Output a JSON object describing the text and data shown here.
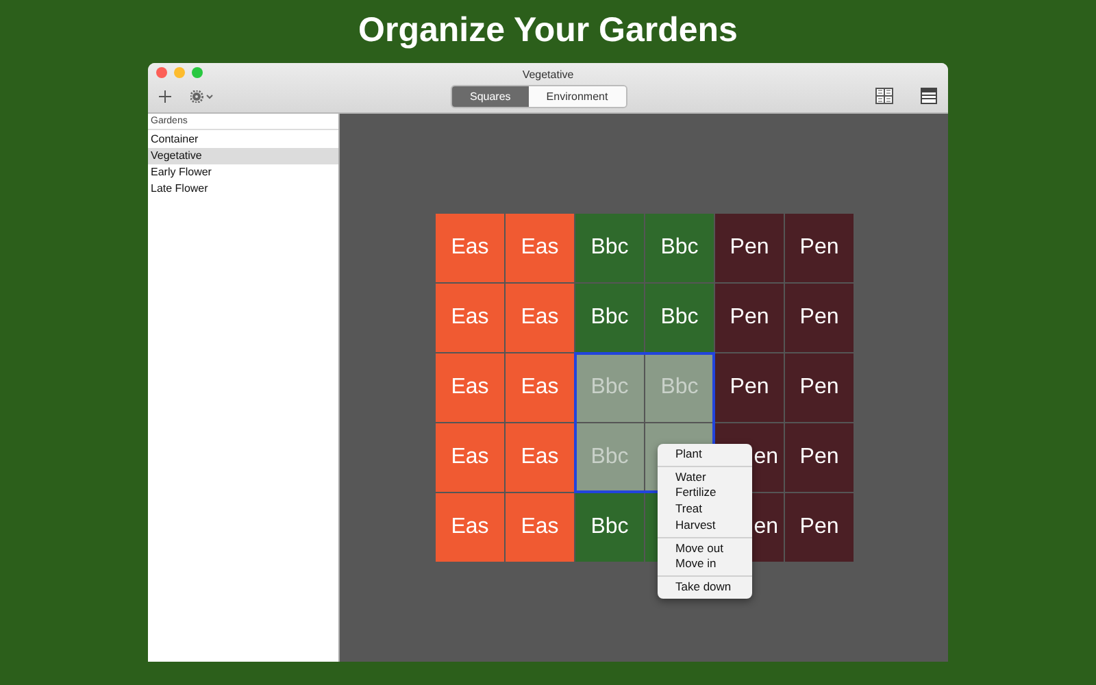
{
  "headline": "Organize Your Gardens",
  "window": {
    "title": "Vegetative"
  },
  "tabs": [
    {
      "label": "Squares",
      "selected": true
    },
    {
      "label": "Environment",
      "selected": false
    }
  ],
  "sidebar": {
    "header": "Gardens",
    "items": [
      {
        "label": "Container",
        "selected": false
      },
      {
        "label": "Vegetative",
        "selected": true
      },
      {
        "label": "Early Flower",
        "selected": false
      },
      {
        "label": "Late Flower",
        "selected": false
      }
    ]
  },
  "grid": {
    "rows": [
      [
        {
          "label": "Eas",
          "color": "#f05a32",
          "selected": false
        },
        {
          "label": "Eas",
          "color": "#f05a32",
          "selected": false
        },
        {
          "label": "Bbc",
          "color": "#2f6a2c",
          "selected": false
        },
        {
          "label": "Bbc",
          "color": "#2f6a2c",
          "selected": false
        },
        {
          "label": "Pen",
          "color": "#4b1f25",
          "selected": false
        },
        {
          "label": "Pen",
          "color": "#4b1f25",
          "selected": false
        }
      ],
      [
        {
          "label": "Eas",
          "color": "#f05a32",
          "selected": false
        },
        {
          "label": "Eas",
          "color": "#f05a32",
          "selected": false
        },
        {
          "label": "Bbc",
          "color": "#2f6a2c",
          "selected": false
        },
        {
          "label": "Bbc",
          "color": "#2f6a2c",
          "selected": false
        },
        {
          "label": "Pen",
          "color": "#4b1f25",
          "selected": false
        },
        {
          "label": "Pen",
          "color": "#4b1f25",
          "selected": false
        }
      ],
      [
        {
          "label": "Eas",
          "color": "#f05a32",
          "selected": false
        },
        {
          "label": "Eas",
          "color": "#f05a32",
          "selected": false
        },
        {
          "label": "Bbc",
          "color": "#8a9b88",
          "selected": true
        },
        {
          "label": "Bbc",
          "color": "#8a9b88",
          "selected": true
        },
        {
          "label": "Pen",
          "color": "#4b1f25",
          "selected": false
        },
        {
          "label": "Pen",
          "color": "#4b1f25",
          "selected": false
        }
      ],
      [
        {
          "label": "Eas",
          "color": "#f05a32",
          "selected": false
        },
        {
          "label": "Eas",
          "color": "#f05a32",
          "selected": false
        },
        {
          "label": "Bbc",
          "color": "#8a9b88",
          "selected": true
        },
        {
          "color": "#8a9b88",
          "selected": true
        },
        {
          "label": "en",
          "partial": true,
          "color": "#4b1f25",
          "selected": false
        },
        {
          "label": "Pen",
          "color": "#4b1f25",
          "selected": false
        }
      ],
      [
        {
          "label": "Eas",
          "color": "#f05a32",
          "selected": false
        },
        {
          "label": "Eas",
          "color": "#f05a32",
          "selected": false
        },
        {
          "label": "Bbc",
          "color": "#2f6a2c",
          "selected": false
        },
        {
          "color": "#2f6a2c",
          "selected": false
        },
        {
          "label": "en",
          "partial": true,
          "color": "#4b1f25",
          "selected": false
        },
        {
          "label": "Pen",
          "color": "#4b1f25",
          "selected": false
        }
      ]
    ]
  },
  "context_menu": [
    [
      "Plant"
    ],
    [
      "Water",
      "Fertilize",
      "Treat",
      "Harvest"
    ],
    [
      "Move out",
      "Move in"
    ],
    [
      "Take down"
    ]
  ]
}
